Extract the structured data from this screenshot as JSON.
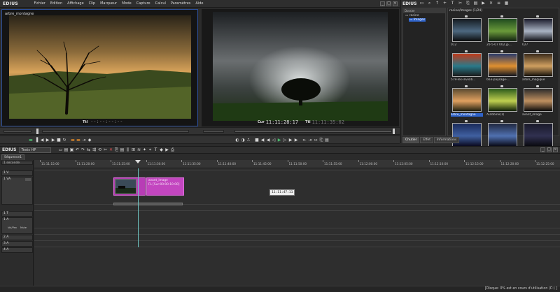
{
  "app": {
    "logo": "EDIUS"
  },
  "menu": [
    "Fichier",
    "Edition",
    "Affichage",
    "Clip",
    "Marqueur",
    "Mode",
    "Capture",
    "Calcul",
    "Paramètres",
    "Aide"
  ],
  "window_buttons": [
    "_",
    "□",
    "×"
  ],
  "player": {
    "clip_label": "arbre_montagne",
    "tc_label": "Ttl",
    "timecode": "--:--:--:--"
  },
  "recorder": {
    "cur_label": "Cur",
    "cur_timecode": "11:11:28:17",
    "ttl_label": "Ttl",
    "ttl_timecode": "11:11:35:02"
  },
  "bin": {
    "logo": "EDIUS",
    "tree_header": "Dossier",
    "tree_items": [
      "racine",
      "Images"
    ],
    "path": "racine/Images (1/24)",
    "thumbnails": [
      {
        "label": "012",
        "selected": false,
        "palette": [
          "#141a1f",
          "#4d6880",
          "#0b0b0b"
        ]
      },
      {
        "label": "20-5-07 002.jp...",
        "selected": false,
        "palette": [
          "#1f4a1f",
          "#6a9a3a",
          "#102010"
        ]
      },
      {
        "label": "027",
        "selected": false,
        "palette": [
          "#1a1a2a",
          "#aab4c4",
          "#0d0d12"
        ]
      },
      {
        "label": "579-les-invisib...",
        "selected": false,
        "palette": [
          "#c03a1a",
          "#2a7a8a",
          "#1a1a1a"
        ]
      },
      {
        "label": "663-paysage-...",
        "selected": false,
        "palette": [
          "#2a3a6a",
          "#e09030",
          "#101520"
        ]
      },
      {
        "label": "arbre_magique",
        "selected": false,
        "palette": [
          "#3a2a1a",
          "#d0a060",
          "#15100a"
        ]
      },
      {
        "label": "arbre_montagne",
        "selected": true,
        "palette": [
          "#5a4a30",
          "#e0a060",
          "#202010"
        ]
      },
      {
        "label": "Autobine(1)",
        "selected": false,
        "palette": [
          "#2a5a1a",
          "#c0d050",
          "#102008"
        ]
      },
      {
        "label": "avant_image",
        "selected": false,
        "palette": [
          "#2a2a2a",
          "#c09060",
          "#0a0a0a"
        ]
      },
      {
        "label": "",
        "selected": false,
        "palette": [
          "#1a2a5a",
          "#4060a0",
          "#0a0a20"
        ]
      },
      {
        "label": "",
        "selected": false,
        "palette": [
          "#202840",
          "#5070b0",
          "#0a0a18"
        ]
      },
      {
        "label": "",
        "selected": false,
        "palette": [
          "#1a1a2a",
          "#303050",
          "#0a0a10"
        ]
      }
    ],
    "tabs": [
      "Chutier",
      "Effet",
      "Informations"
    ]
  },
  "timeline": {
    "logo": "EDIUS",
    "project": "Tests HP",
    "sequence_tab": "Séquence1",
    "scale_label": "1 seconde",
    "tracks": [
      {
        "label": "1 V",
        "type": "video"
      },
      {
        "label": "1 VA",
        "type": "video"
      },
      {
        "label": "1 T",
        "type": "title"
      },
      {
        "label": "1 A",
        "type": "audio"
      },
      {
        "label": "2 A",
        "type": "audio"
      },
      {
        "label": "3 A",
        "type": "audio"
      },
      {
        "label": "4 A",
        "type": "audio"
      }
    ],
    "ruler": [
      "11:11:15:00",
      "11:11:20:00",
      "11:11:25:00",
      "11:11:30:00",
      "11:11:35:00",
      "11:11:40:00",
      "11:11:45:00",
      "11:11:50:00",
      "11:11:55:00",
      "11:12:00:00",
      "11:12:05:00",
      "11:12:10:00",
      "11:12:15:00",
      "11:12:20:00",
      "11:12:25:00"
    ],
    "clip": {
      "name": "avant_image",
      "info": "FL [Sur:00:00:10:00]"
    },
    "cursor_tooltip": "11:11:47:11",
    "audio_sub": [
      "Vol/Pan",
      "Mute"
    ]
  },
  "status": {
    "text": "[Disque: 0% est en cours d'utilisation (C:) ]"
  }
}
